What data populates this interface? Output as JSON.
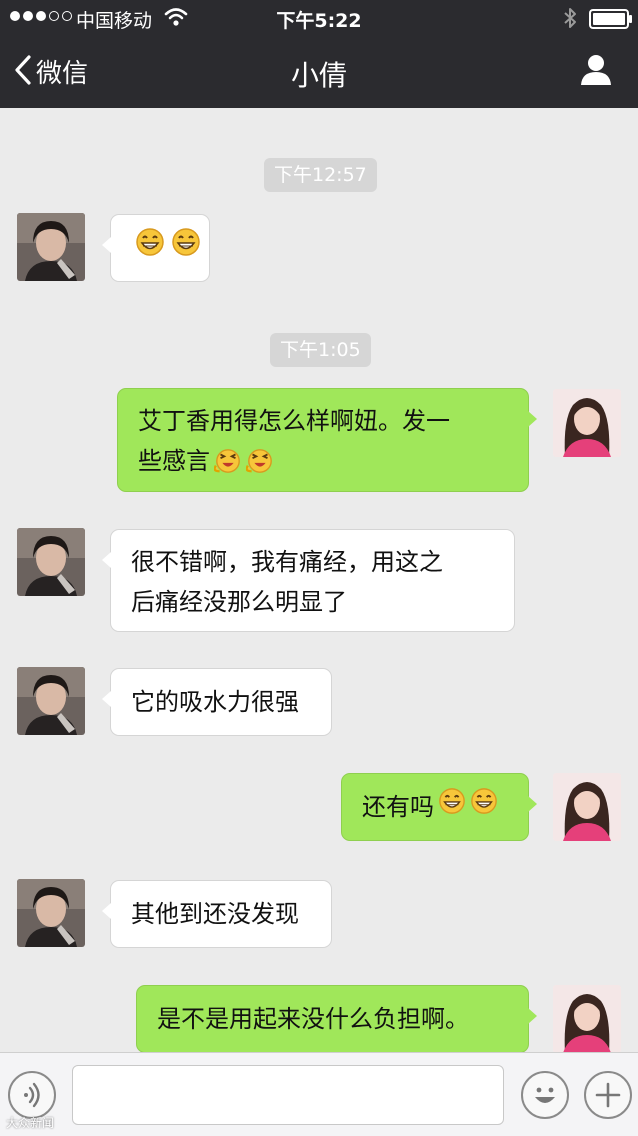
{
  "status_bar": {
    "carrier": "中国移动",
    "time": "下午5:22"
  },
  "nav": {
    "back_label": "微信",
    "title": "小倩"
  },
  "messages": [
    {
      "kind": "timestamp",
      "text": "下午12:57"
    },
    {
      "kind": "incoming",
      "text": "",
      "emojis": [
        "grin-emoji",
        "grin-emoji"
      ]
    },
    {
      "kind": "timestamp",
      "text": "下午1:05"
    },
    {
      "kind": "outgoing",
      "lines": [
        "艾丁香用得怎么样啊妞。发一",
        "些感言"
      ],
      "emojis": [
        "laugh-emoji",
        "laugh-emoji"
      ]
    },
    {
      "kind": "incoming",
      "lines": [
        "很不错啊，我有痛经，用这之",
        "后痛经没那么明显了"
      ]
    },
    {
      "kind": "incoming",
      "text": "它的吸水力很强"
    },
    {
      "kind": "outgoing",
      "text": "还有吗",
      "emojis": [
        "grin-emoji",
        "grin-emoji"
      ]
    },
    {
      "kind": "incoming",
      "text": "其他到还没发现"
    },
    {
      "kind": "outgoing",
      "text": "是不是用起来没什么负担啊。"
    }
  ],
  "input_bar": {
    "text_value": "",
    "voice_icon": "voice-icon",
    "emoji_icon": "emoji-icon",
    "plus_icon": "plus-icon"
  },
  "watermark": "大众新闻",
  "colors": {
    "bar_background": "#2b2b2f",
    "chat_background": "#ebebeb",
    "outgoing_bubble": "#a0e75a",
    "incoming_bubble": "#ffffff"
  }
}
